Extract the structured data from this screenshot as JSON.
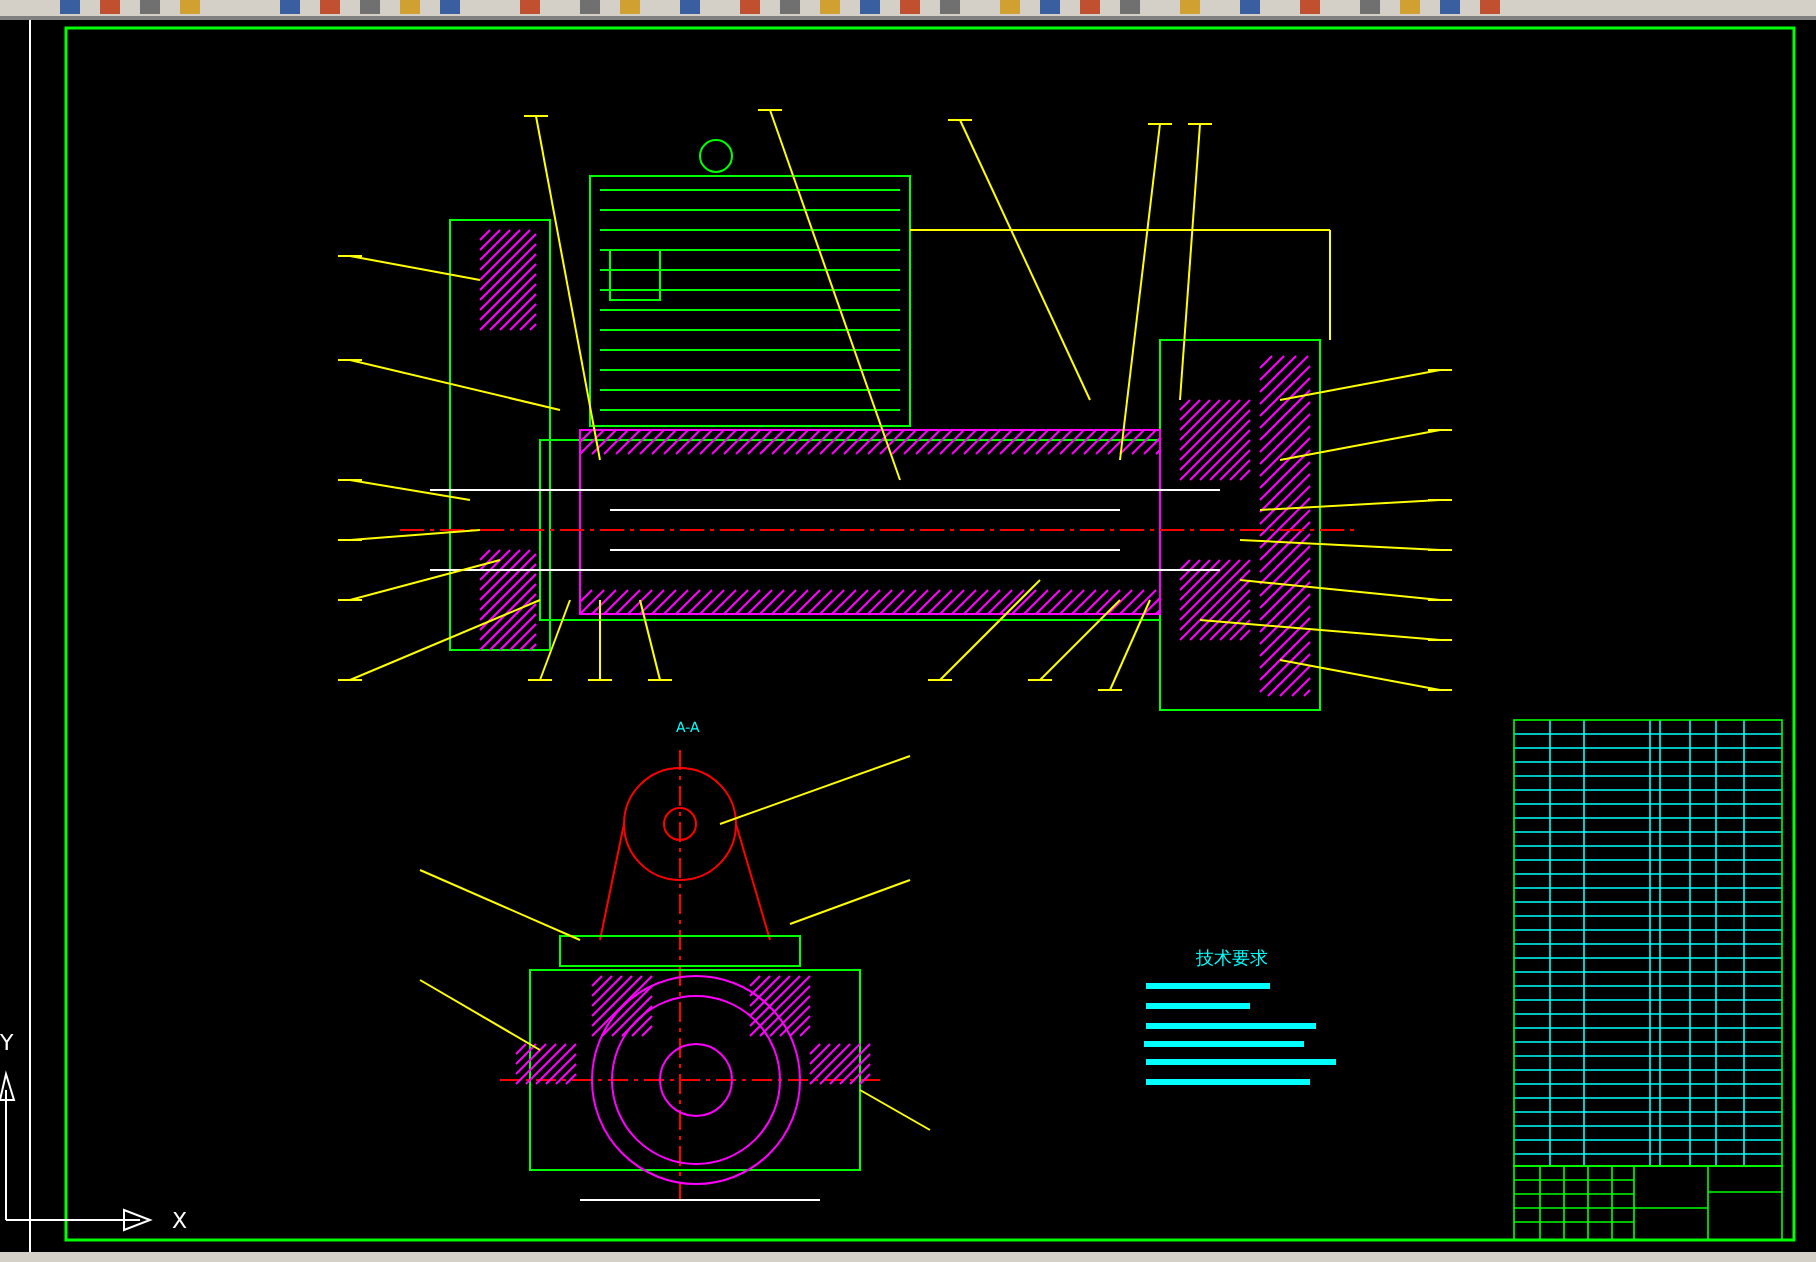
{
  "section_view": {
    "label": "A-A"
  },
  "notes": {
    "title": "技术要求"
  },
  "ucs": {
    "x_label": "X",
    "y_label": "Y"
  }
}
